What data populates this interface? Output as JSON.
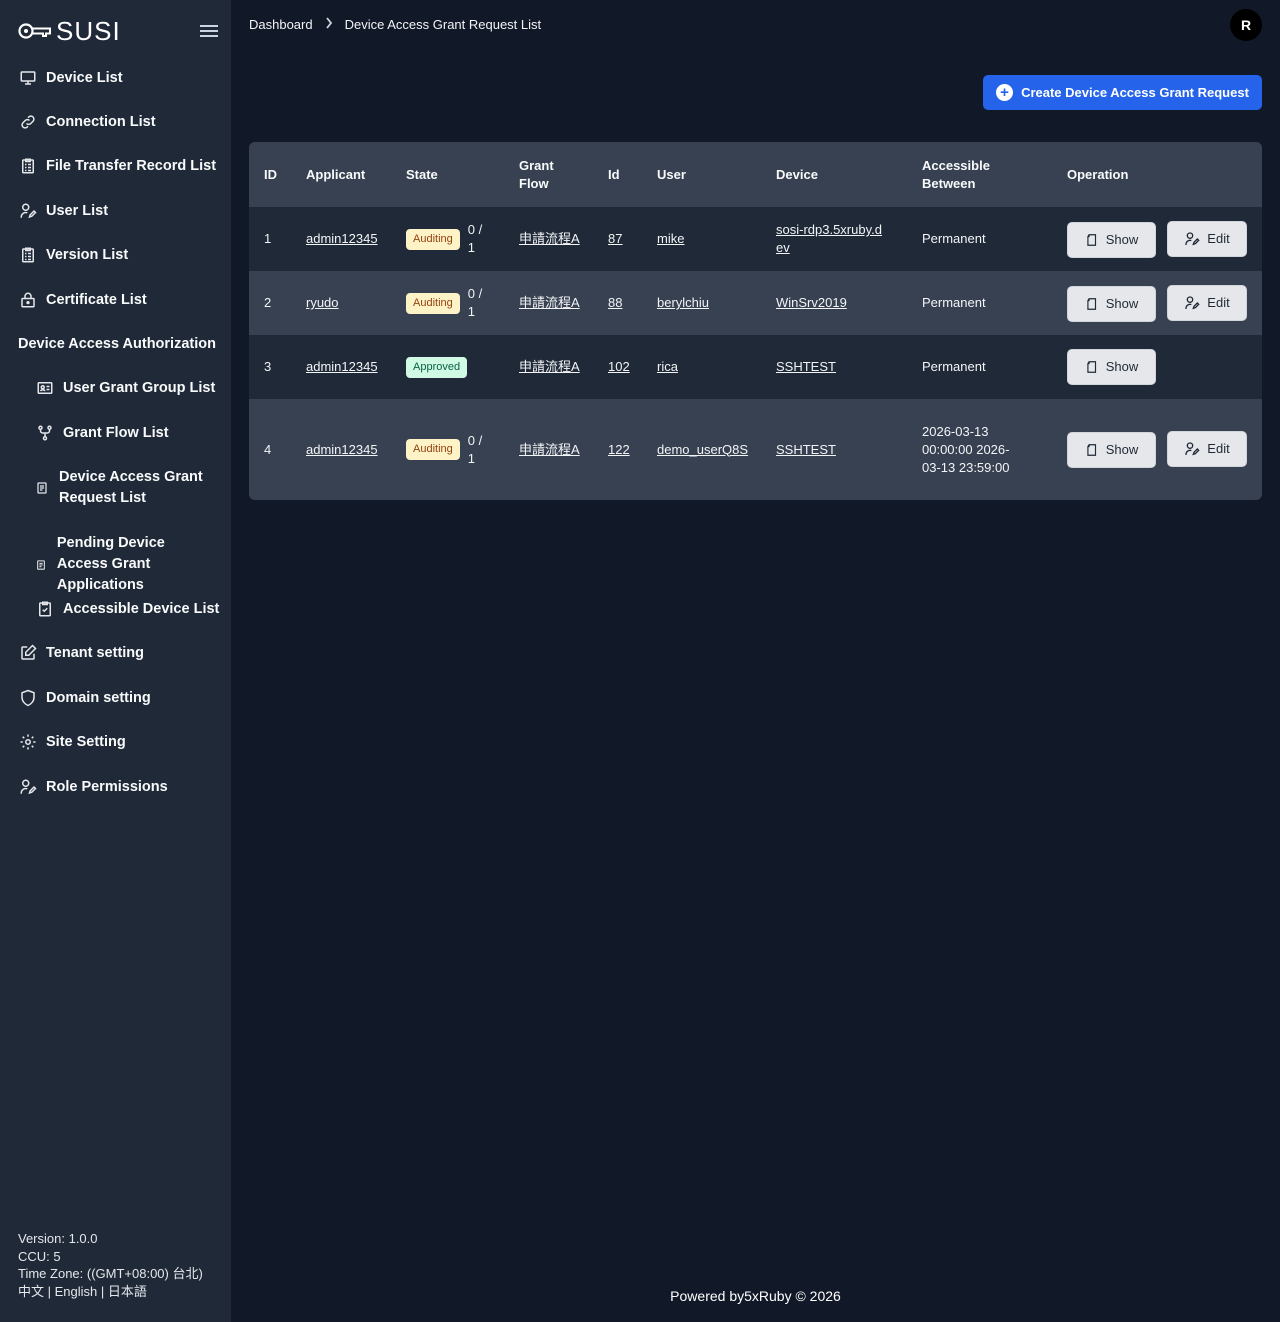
{
  "app": {
    "logo_text": "SUSI",
    "breadcrumb": [
      "Dashboard",
      "Device Access Grant Request List"
    ],
    "avatar_initial": "R"
  },
  "sidebar": {
    "items": [
      {
        "label": "Device List",
        "icon": "monitor-icon"
      },
      {
        "label": "Connection List",
        "icon": "link-icon"
      },
      {
        "label": "File Transfer Record List",
        "icon": "clipboard-list-icon"
      },
      {
        "label": "User List",
        "icon": "user-edit-icon"
      },
      {
        "label": "Version List",
        "icon": "clipboard-list-icon"
      },
      {
        "label": "Certificate List",
        "icon": "lock-icon"
      }
    ],
    "group_label": "Device Access Authorization",
    "sub_items": [
      {
        "label": "User Grant Group List",
        "icon": "id-card-icon"
      },
      {
        "label": "Grant Flow List",
        "icon": "flow-branch-icon"
      },
      {
        "label": "Device Access Grant Request List",
        "icon": "small-doc-icon"
      },
      {
        "label": "Pending Device Access Grant Applications",
        "icon": "small-doc-icon"
      },
      {
        "label": "Accessible Device List",
        "icon": "clipboard-check-icon"
      }
    ],
    "bottom_items": [
      {
        "label": "Tenant setting",
        "icon": "edit-square-icon"
      },
      {
        "label": "Domain setting",
        "icon": "shield-icon"
      },
      {
        "label": "Site Setting",
        "icon": "gear-icon"
      },
      {
        "label": "Role Permissions",
        "icon": "user-edit-icon"
      }
    ],
    "footer": {
      "version": "Version: 1.0.0",
      "ccu": "CCU: 5",
      "timezone": "Time Zone: ((GMT+08:00) 台北)",
      "languages": [
        "中文",
        "English",
        "日本語"
      ],
      "lang_sep": " | "
    }
  },
  "toolbar": {
    "create_label": "Create Device Access Grant Request"
  },
  "table": {
    "headers": [
      "ID",
      "Applicant",
      "State",
      "Grant Flow",
      "Id",
      "User",
      "Device",
      "Accessible Between",
      "Operation"
    ],
    "show_label": "Show",
    "edit_label": "Edit",
    "rows": [
      {
        "id": "1",
        "applicant": "admin12345",
        "state": "Auditing",
        "progress": "0 / 1",
        "grant_flow": "申請流程A",
        "gid": "87",
        "user": "mike",
        "device": "sosi-rdp3.5xruby.dev",
        "between": "Permanent",
        "editable": true
      },
      {
        "id": "2",
        "applicant": "ryudo",
        "state": "Auditing",
        "progress": "0 / 1",
        "grant_flow": "申請流程A",
        "gid": "88",
        "user": "berylchiu",
        "device": "WinSrv2019",
        "between": "Permanent",
        "editable": true
      },
      {
        "id": "3",
        "applicant": "admin12345",
        "state": "Approved",
        "progress": "",
        "grant_flow": "申請流程A",
        "gid": "102",
        "user": "rica",
        "device": "SSHTEST",
        "between": "Permanent",
        "editable": false
      },
      {
        "id": "4",
        "applicant": "admin12345",
        "state": "Auditing",
        "progress": "0 / 1",
        "grant_flow": "申請流程A",
        "gid": "122",
        "user": "demo_userQ8S",
        "device": "SSHTEST",
        "between": "2026-03-13 00:00:00 2026-03-13 23:59:00",
        "editable": true
      }
    ]
  },
  "footer": {
    "text": "Powered by5xRuby © 2026"
  },
  "colors": {
    "background": "#111827",
    "sidebar": "#1f2937",
    "accent": "#2563eb",
    "auditing_badge": "#fef3c7",
    "approved_badge": "#d1fae5"
  }
}
